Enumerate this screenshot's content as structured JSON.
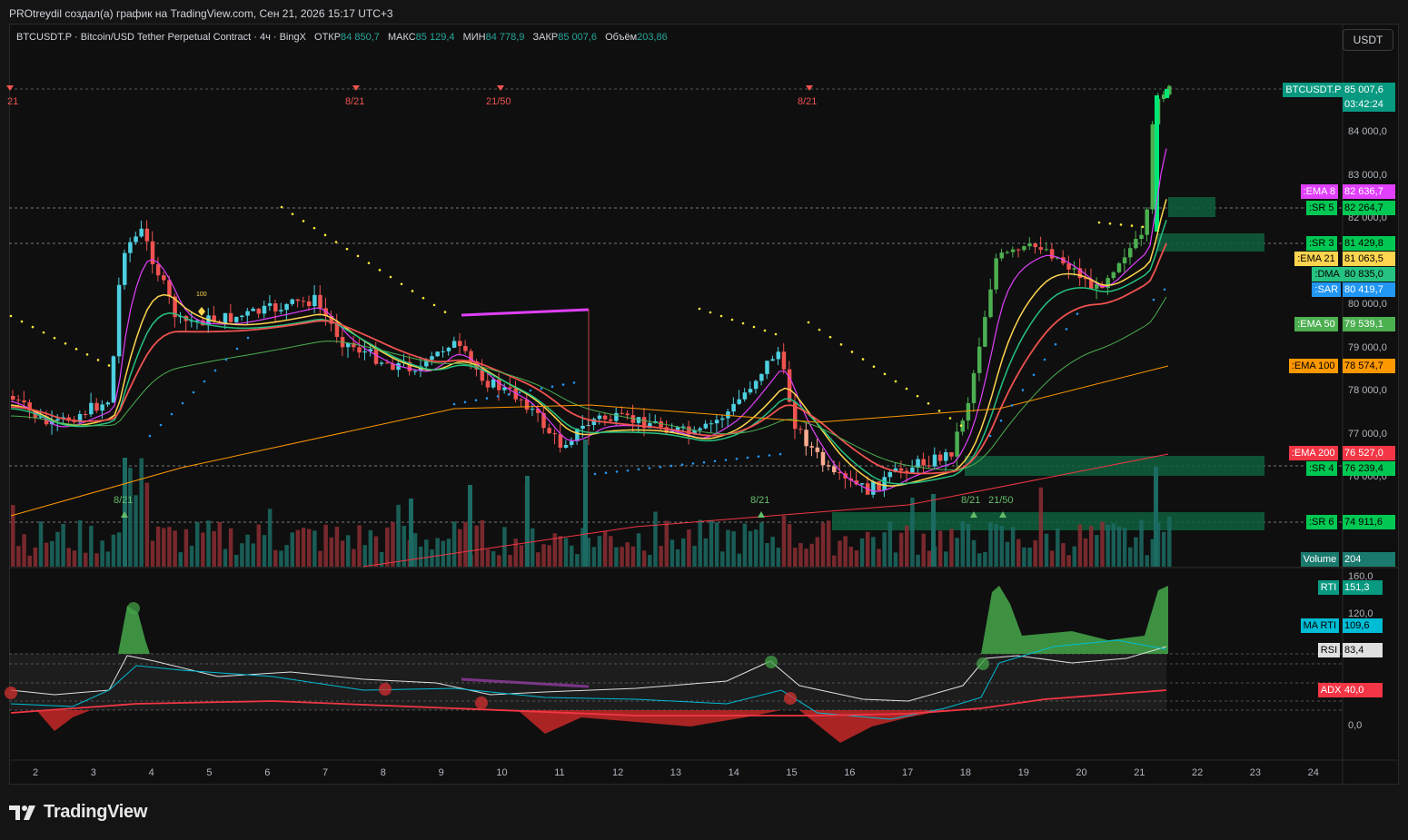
{
  "header": {
    "title": "PROtreydil создал(а) график на TradingView.com, Сен 21, 2026 15:17 UTC+3"
  },
  "legend": {
    "symbol": "BTCUSDT.P · Bitcoin/USD Tether Perpetual Contract · 4ч · BingX",
    "open_label": "ОТКР",
    "open": "84 850,7",
    "high_label": "МАКС",
    "high": "85 129,4",
    "low_label": "МИН",
    "low": "84 778,9",
    "close_label": "ЗАКР",
    "close": "85 007,6",
    "vol_label": "Объём",
    "vol": "203,86"
  },
  "currency_button": "USDT",
  "price_axis": [
    "84 000,0",
    "83 000,0",
    "82 000,0",
    "81 000,0",
    "80 000,0",
    "79 000,0",
    "78 000,0",
    "77 000,0",
    "76 000,0"
  ],
  "osc_axis": [
    "160,0",
    "120,0",
    "0,0"
  ],
  "time_axis": [
    "2",
    "3",
    "4",
    "5",
    "6",
    "7",
    "8",
    "9",
    "10",
    "11",
    "12",
    "13",
    "14",
    "15",
    "16",
    "17",
    "18",
    "19",
    "20",
    "21",
    "22",
    "23",
    "24"
  ],
  "price_tags": [
    {
      "name": "BTCUSDT.P",
      "value": "85 007,6",
      "extra": "03:42:24",
      "bg": "#089981",
      "fg": "#ffffff"
    },
    {
      "name": ":EMA 8",
      "value": "82 636,7",
      "bg": "#e040fb",
      "fg": "#ffffff"
    },
    {
      "name": ":SR 5",
      "value": "82 264,7",
      "bg": "#00c853",
      "fg": "#000000"
    },
    {
      "name": ":SR 3",
      "value": "81 429,8",
      "bg": "#00c853",
      "fg": "#000000"
    },
    {
      "name": ":EMA 21",
      "value": "81 063,5",
      "bg": "#ffd54f",
      "fg": "#000000"
    },
    {
      "name": ":DMA",
      "value": "80 835,0",
      "bg": "#26c281",
      "fg": "#000000"
    },
    {
      "name": ":SAR",
      "value": "80 419,7",
      "bg": "#2196f3",
      "fg": "#ffffff"
    },
    {
      "name": ":EMA 50",
      "value": "79 539,1",
      "bg": "#4caf50",
      "fg": "#ffffff"
    },
    {
      "name": ":EMA 100",
      "value": "78 574,7",
      "bg": "#ff9800",
      "fg": "#000000"
    },
    {
      "name": ":EMA 200",
      "value": "76 527,0",
      "bg": "#f23645",
      "fg": "#ffffff"
    },
    {
      "name": ":SR 4",
      "value": "76 239,4",
      "bg": "#00c853",
      "fg": "#000000"
    },
    {
      "name": ":SR 6",
      "value": "74 911,6",
      "bg": "#00c853",
      "fg": "#000000"
    },
    {
      "name": "Volume",
      "value": "204",
      "bg": "#1b7a6e",
      "fg": "#ffffff"
    }
  ],
  "osc_tags": [
    {
      "name": "RTI",
      "value": "151,3",
      "bg": "#089981",
      "fg": "#ffffff"
    },
    {
      "name": "MA RTI",
      "value": "109,6",
      "bg": "#00bcd4",
      "fg": "#000000"
    },
    {
      "name": "RSI",
      "value": "83,4",
      "bg": "#e0e0e0",
      "fg": "#000000"
    },
    {
      "name": "ADX",
      "value": "40,0",
      "bg": "#f23645",
      "fg": "#ffffff"
    }
  ],
  "markers_top": [
    "21",
    "8/21",
    "21/50",
    "8/21"
  ],
  "markers_bottom": [
    "8/21",
    "8/21",
    "8/21",
    "21/50"
  ],
  "small_marker": "100",
  "brand": "TradingView",
  "colors": {
    "up": "#26a69a",
    "down": "#ef5350",
    "up_bright": "#4dd0e1"
  }
}
